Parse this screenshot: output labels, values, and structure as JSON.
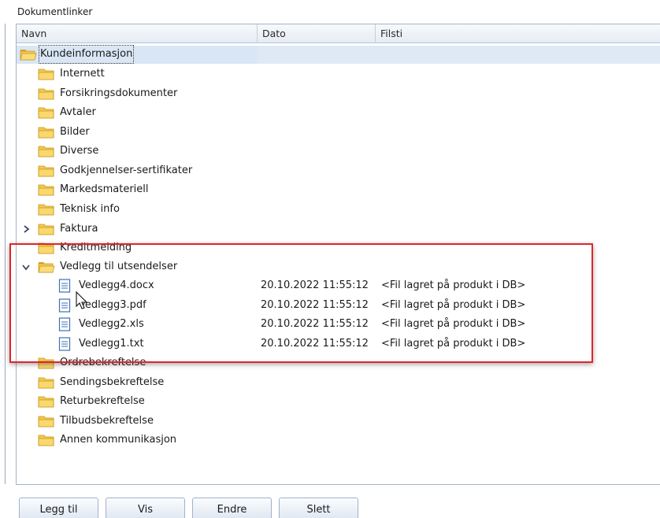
{
  "group_label": "Dokumentlinker",
  "columns": {
    "navn": "Navn",
    "dato": "Dato",
    "filsti": "Filsti"
  },
  "tree": {
    "root": "Kundeinformasjon",
    "folders_a": [
      "Internett",
      "Forsikringsdokumenter",
      "Avtaler",
      "Bilder",
      "Diverse",
      "Godkjennelser-sertifikater",
      "Markedsmateriell",
      "Teknisk info"
    ],
    "faktura": "Faktura",
    "kreditt": "Kreditmelding",
    "vedlegg_folder": "Vedlegg til utsendelser",
    "files": [
      {
        "name": "Vedlegg4.docx",
        "date": "20.10.2022 11:55:12",
        "path": "<Fil lagret på produkt i DB>"
      },
      {
        "name": "Vedlegg3.pdf",
        "date": "20.10.2022 11:55:12",
        "path": "<Fil lagret på produkt i DB>"
      },
      {
        "name": "Vedlegg2.xls",
        "date": "20.10.2022 11:55:12",
        "path": "<Fil lagret på produkt i DB>"
      },
      {
        "name": "Vedlegg1.txt",
        "date": "20.10.2022 11:55:12",
        "path": "<Fil lagret på produkt i DB>"
      }
    ],
    "folders_b": [
      "Ordrebekreftelse",
      "Sendingsbekreftelse",
      "Returbekreftelse",
      "Tilbudsbekreftelse",
      "Annen kommunikasjon"
    ]
  },
  "buttons": {
    "add": "Legg til",
    "view": "Vis",
    "edit": "Endre",
    "delete": "Slett"
  },
  "colors": {
    "folder": "#f5c84c",
    "folder_dark": "#d9a227",
    "selection": "#d9e6f5",
    "highlight": "#e0252b"
  }
}
